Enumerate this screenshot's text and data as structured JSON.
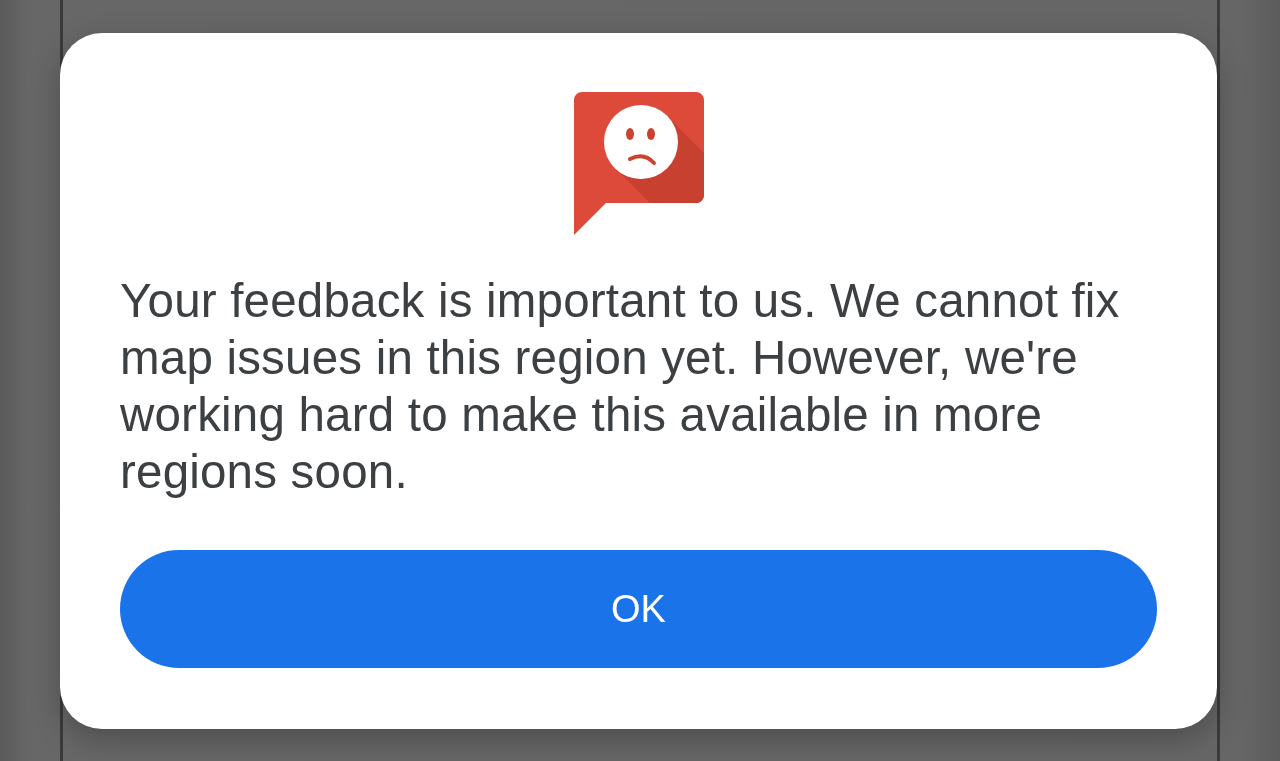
{
  "dialog": {
    "message": "Your feedback is important to us. We cannot fix map issues in this region yet. However, we're working hard to make this available in more regions soon.",
    "button": {
      "label": "OK",
      "kind": "primary"
    }
  }
}
